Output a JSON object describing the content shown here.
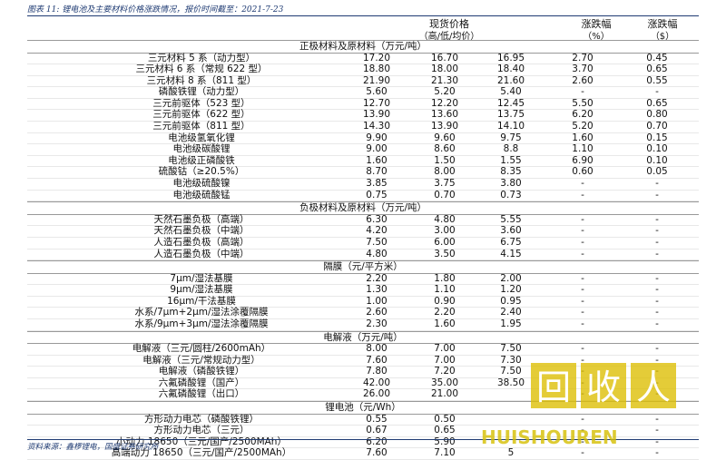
{
  "caption": "图表 11: 锂电池及主要材料价格涨跌情况，报价时间截至：2021-7-23",
  "header": {
    "current_price": "现货价格",
    "price_sub": "（高/低/均价）",
    "change_pct": "涨跌幅",
    "change_pct_unit": "（%）",
    "change_abs": "涨跌幅",
    "change_abs_unit": "（$）"
  },
  "sections": [
    {
      "title": "正极材料及原材料（万元/吨）",
      "rows": [
        {
          "label": "三元材料 5 系（动力型）",
          "v1": "17.20",
          "v2": "16.70",
          "v3": "16.95",
          "v4": "2.70",
          "v5": "0.45"
        },
        {
          "label": "三元材料 6 系（常规 622 型）",
          "v1": "18.80",
          "v2": "18.00",
          "v3": "18.40",
          "v4": "3.70",
          "v5": "0.65"
        },
        {
          "label": "三元材料 8 系（811 型）",
          "v1": "21.90",
          "v2": "21.30",
          "v3": "21.60",
          "v4": "2.60",
          "v5": "0.55"
        },
        {
          "label": "磷酸铁锂（动力型）",
          "v1": "5.60",
          "v2": "5.20",
          "v3": "5.40",
          "v4": "-",
          "v5": "-"
        },
        {
          "label": "三元前驱体（523 型）",
          "v1": "12.70",
          "v2": "12.20",
          "v3": "12.45",
          "v4": "5.50",
          "v5": "0.65"
        },
        {
          "label": "三元前驱体（622 型）",
          "v1": "13.90",
          "v2": "13.60",
          "v3": "13.75",
          "v4": "6.20",
          "v5": "0.80"
        },
        {
          "label": "三元前驱体（811 型）",
          "v1": "14.30",
          "v2": "13.90",
          "v3": "14.10",
          "v4": "5.20",
          "v5": "0.70"
        },
        {
          "label": "电池级氢氧化锂",
          "v1": "9.90",
          "v2": "9.60",
          "v3": "9.75",
          "v4": "1.60",
          "v5": "0.15"
        },
        {
          "label": "电池级碳酸锂",
          "v1": "9.00",
          "v2": "8.60",
          "v3": "8.8",
          "v4": "1.10",
          "v5": "0.10"
        },
        {
          "label": "电池级正磷酸铁",
          "v1": "1.60",
          "v2": "1.50",
          "v3": "1.55",
          "v4": "6.90",
          "v5": "0.10"
        },
        {
          "label": "硫酸钴（≥20.5%）",
          "v1": "8.70",
          "v2": "8.00",
          "v3": "8.35",
          "v4": "0.60",
          "v5": "0.05"
        },
        {
          "label": "电池级硫酸镍",
          "v1": "3.85",
          "v2": "3.75",
          "v3": "3.80",
          "v4": "-",
          "v5": "-"
        },
        {
          "label": "电池级硫酸锰",
          "v1": "0.75",
          "v2": "0.70",
          "v3": "0.73",
          "v4": "-",
          "v5": "-"
        }
      ]
    },
    {
      "title": "负极材料及原材料（万元/吨）",
      "rows": [
        {
          "label": "天然石墨负极（高端）",
          "v1": "6.30",
          "v2": "4.80",
          "v3": "5.55",
          "v4": "-",
          "v5": "-"
        },
        {
          "label": "天然石墨负极（中端）",
          "v1": "4.20",
          "v2": "3.00",
          "v3": "3.60",
          "v4": "-",
          "v5": "-"
        },
        {
          "label": "人造石墨负极（高端）",
          "v1": "7.50",
          "v2": "6.00",
          "v3": "6.75",
          "v4": "-",
          "v5": "-"
        },
        {
          "label": "人造石墨负极（中端）",
          "v1": "4.80",
          "v2": "3.50",
          "v3": "4.15",
          "v4": "-",
          "v5": "-"
        }
      ]
    },
    {
      "title": "隔膜（元/平方米）",
      "rows": [
        {
          "label": "7μm/湿法基膜",
          "v1": "2.20",
          "v2": "1.80",
          "v3": "2.00",
          "v4": "-",
          "v5": "-"
        },
        {
          "label": "9μm/湿法基膜",
          "v1": "1.30",
          "v2": "1.10",
          "v3": "1.20",
          "v4": "-",
          "v5": "-"
        },
        {
          "label": "16μm/干法基膜",
          "v1": "1.00",
          "v2": "0.90",
          "v3": "0.95",
          "v4": "-",
          "v5": "-"
        },
        {
          "label": "水系/7μm+2μm/湿法涂覆隔膜",
          "v1": "2.60",
          "v2": "2.20",
          "v3": "2.40",
          "v4": "-",
          "v5": "-"
        },
        {
          "label": "水系/9μm+3μm/湿法涂覆隔膜",
          "v1": "2.30",
          "v2": "1.60",
          "v3": "1.95",
          "v4": "-",
          "v5": "-"
        }
      ]
    },
    {
      "title": "电解液（万元/吨）",
      "rows": [
        {
          "label": "电解液（三元/圆柱/2600mAh）",
          "v1": "8.00",
          "v2": "7.00",
          "v3": "7.50",
          "v4": "-",
          "v5": "-"
        },
        {
          "label": "电解液（三元/常规动力型）",
          "v1": "7.60",
          "v2": "7.00",
          "v3": "7.30",
          "v4": "-",
          "v5": "-"
        },
        {
          "label": "电解液（磷酸铁锂）",
          "v1": "7.80",
          "v2": "7.20",
          "v3": "7.50",
          "v4": "-",
          "v5": "-"
        },
        {
          "label": "六氟磷酸锂（国产）",
          "v1": "42.00",
          "v2": "35.00",
          "v3": "38.50",
          "v4": "-",
          "v5": "-"
        },
        {
          "label": "六氟磷酸锂（出口）",
          "v1": "26.00",
          "v2": "21.00",
          "v3": "",
          "v4": "-",
          "v5": "-"
        }
      ]
    },
    {
      "title": "锂电池（元/Wh）",
      "rows": [
        {
          "label": "方形动力电芯（磷酸铁锂）",
          "v1": "0.55",
          "v2": "0.50",
          "v3": "",
          "v4": "-",
          "v5": "-"
        },
        {
          "label": "方形动力电芯（三元）",
          "v1": "0.67",
          "v2": "0.65",
          "v3": "",
          "v4": "-",
          "v5": "-"
        },
        {
          "label": "小动力 18650（三元/国产/2500MAh）",
          "v1": "6.20",
          "v2": "5.90",
          "v3": "",
          "v4": "-",
          "v5": "-"
        },
        {
          "label": "高端动力 18650（三元/国产/2500MAh）",
          "v1": "7.60",
          "v2": "7.10",
          "v3": "5",
          "v4": "-",
          "v5": "-"
        }
      ]
    }
  ],
  "source": "资料来源：鑫椤锂电，国盛证券研究所",
  "watermark": {
    "brand": "回收人",
    "text": "HUISHOUREN"
  }
}
